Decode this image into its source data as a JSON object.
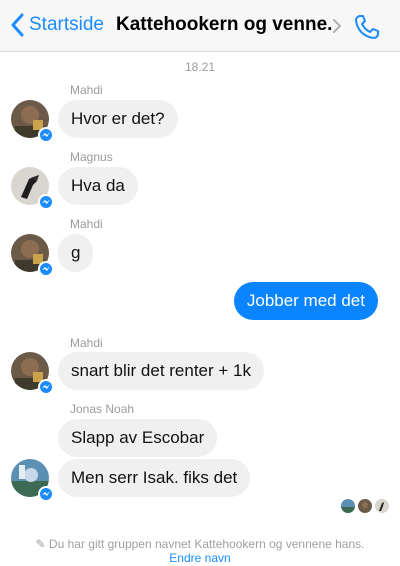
{
  "header": {
    "back_label": "Startside",
    "title": "Kattehookern og venne...",
    "back_icon": "chevron-left-icon",
    "title_icon": "chevron-right-icon",
    "call_icon": "phone-icon",
    "accent": "#1a8cff"
  },
  "timestamp": "18.21",
  "messages": [
    {
      "sender": "Mahdi",
      "text": "Hvor er det?"
    },
    {
      "sender": "Magnus",
      "text": "Hva da"
    },
    {
      "sender": "Mahdi",
      "text": "g"
    },
    {
      "sender": "",
      "text": "Jobber med det",
      "own": true
    },
    {
      "sender": "Mahdi",
      "text": "snart blir det renter + 1k"
    },
    {
      "sender": "Jonas Noah",
      "text": "Slapp av Escobar"
    },
    {
      "sender": "",
      "text": "Men serr Isak. fiks det"
    }
  ],
  "badge_icon": "messenger-badge-icon",
  "seen_icons": [
    "seen-avatar-jonas",
    "seen-avatar-mahdi",
    "seen-avatar-magnus"
  ],
  "notice": "Du har gitt gruppen navnet Kattehookern og vennene hans.",
  "notice_icon": "pencil-icon",
  "notice_link": "Endre navn",
  "colors": {
    "own_bubble": "#0a84ff",
    "other_bubble": "#f1f0f0",
    "meta_text": "#9b9b9b"
  }
}
